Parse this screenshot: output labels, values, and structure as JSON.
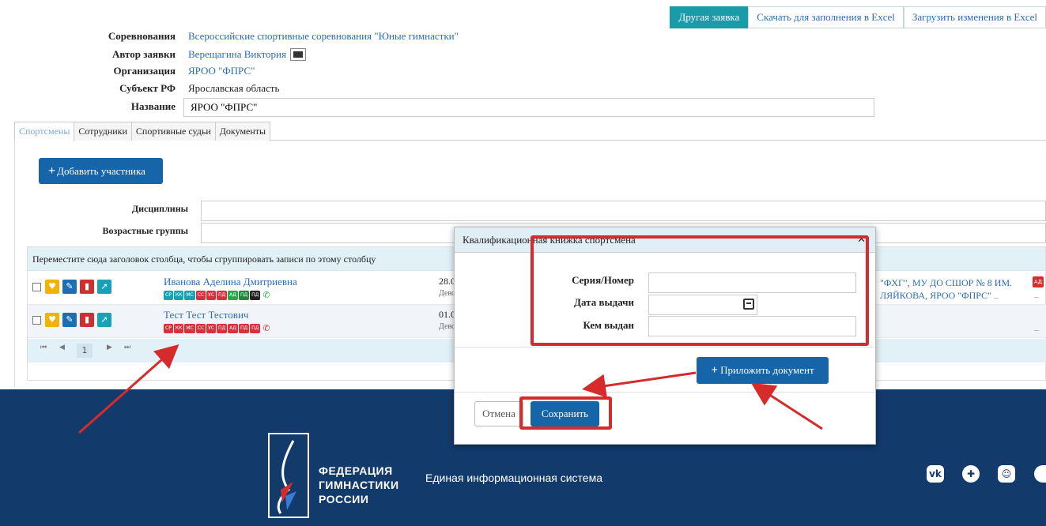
{
  "top_actions": {
    "other_request": "Другая заявка",
    "download_excel": "Скачать для заполнения в Excel",
    "upload_changes": "Загрузить изменения в Excel"
  },
  "info": {
    "competition_label": "Соревнования",
    "competition_value": "Всероссийские спортивные соревнования \"Юные гимнастки\"",
    "author_label": "Автор заявки",
    "author_value": "Верещагина Виктория",
    "org_label": "Организация",
    "org_value": "ЯРОО \"ФПРС\"",
    "region_label": "Субъект РФ",
    "region_value": "Ярославская область",
    "name_label": "Название",
    "name_value": "ЯРОО \"ФПРС\""
  },
  "tabs": [
    "Спортсмены",
    "Сотрудники",
    "Спортивные судьи",
    "Документы"
  ],
  "add_participant": "Добавить участника",
  "filters": {
    "disciplines_label": "Дисциплины",
    "age_groups_label": "Возрастные группы"
  },
  "grid": {
    "group_hint": "Переместите сюда заголовок столбца, чтобы сгруппировать записи по этому столбцу",
    "rows": [
      {
        "name": "Иванова Аделина Дмитриевна",
        "date": "28.0",
        "sex": "Девс",
        "badges": [
          "СР",
          "КК",
          "МС",
          "СС",
          "УС",
          "ПД",
          "АД",
          "ПД",
          "ПД"
        ],
        "org_line1": "\"ФХГ\", МУ ДО СШОР № 8 ИМ.",
        "org_line2": "ЛЯЙКОВА, ЯРОО \"ФПРС\"",
        "more": "...",
        "tag": "АД"
      },
      {
        "name": "Тест Тест Тестович",
        "date": "01.0",
        "sex": "Девс",
        "badges": [
          "СР",
          "КК",
          "МС",
          "СС",
          "УС",
          "ПД",
          "АД",
          "ПД",
          "ПД"
        ],
        "more": "..."
      }
    ],
    "page": "1"
  },
  "modal": {
    "title": "Квалификационная книжка спортсмена",
    "series_label": "Серия/Номер",
    "issue_date_label": "Дата выдачи",
    "issued_by_label": "Кем выдан",
    "attach_label": "Приложить документ",
    "cancel_label": "Отмена",
    "save_label": "Сохранить"
  },
  "footer": {
    "federation_line1": "ФЕДЕРАЦИЯ",
    "federation_line2": "ГИМНАСТИКИ",
    "federation_line3": "РОССИИ",
    "system": "Единая информационная система"
  },
  "colors": {
    "primary": "#1565a8",
    "teal": "#1a9ba8",
    "footer": "#123a6b",
    "highlight": "#d62b2b"
  }
}
